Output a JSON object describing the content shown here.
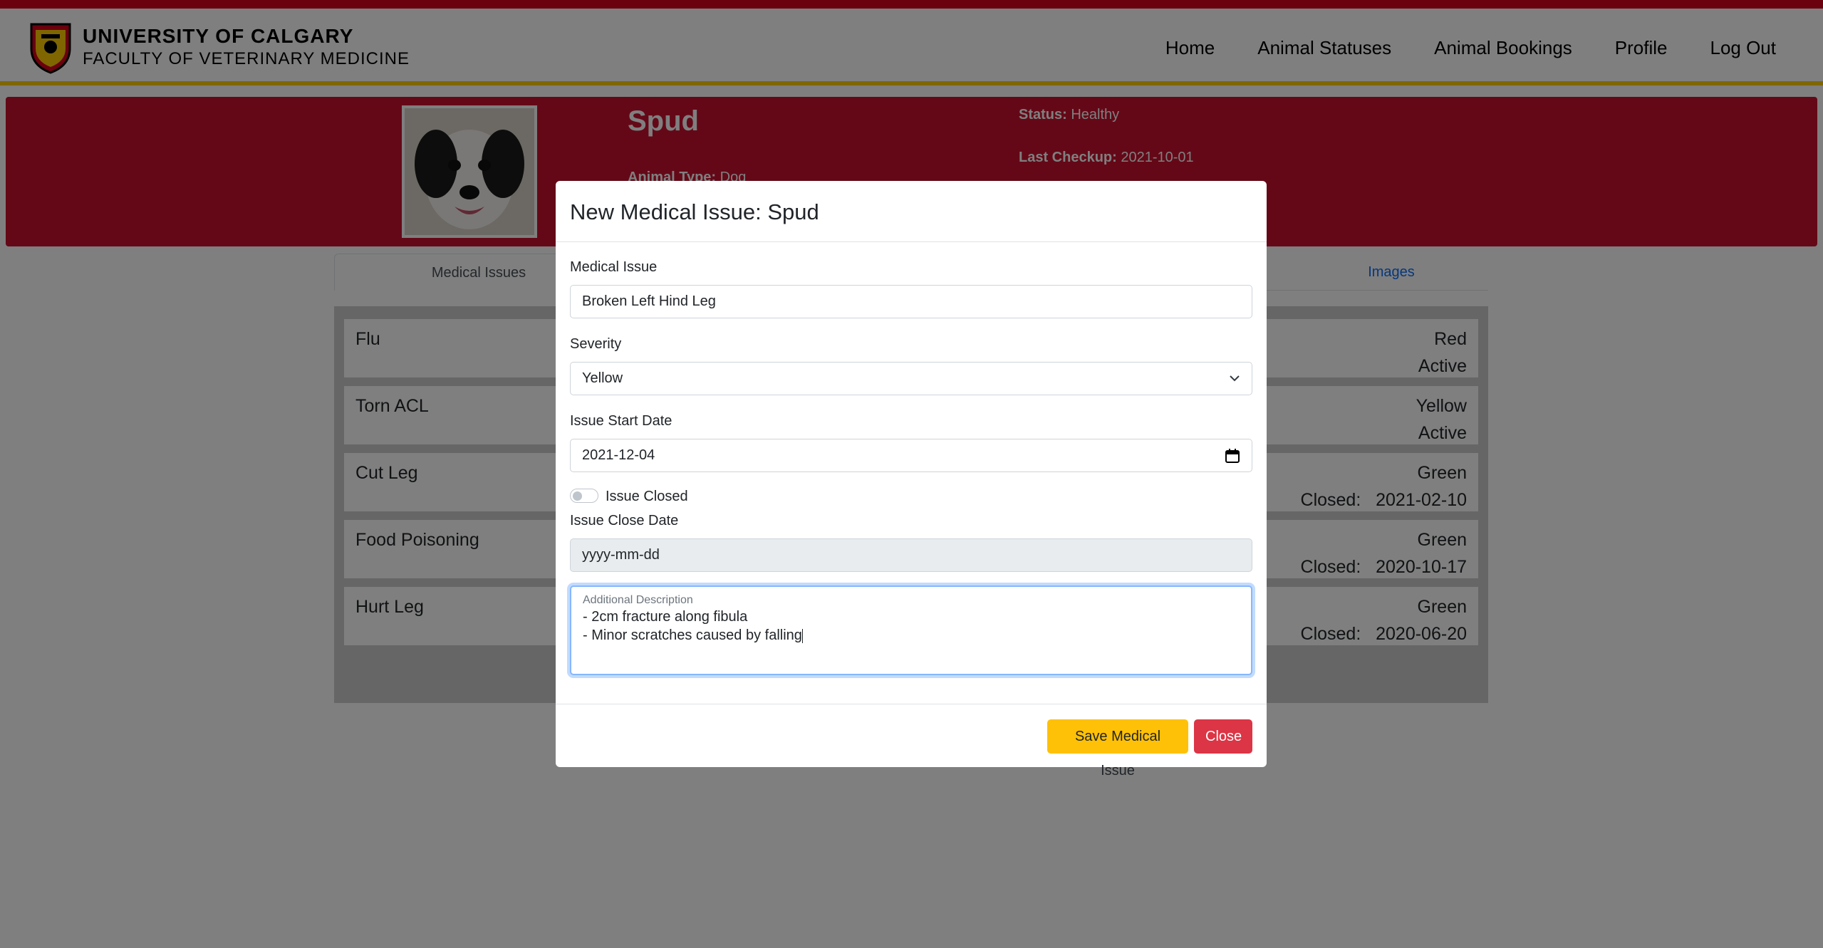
{
  "brand": {
    "line1": "UNIVERSITY OF CALGARY",
    "line2": "FACULTY OF VETERINARY MEDICINE"
  },
  "nav": {
    "home": "Home",
    "animal_statuses": "Animal Statuses",
    "animal_bookings": "Animal Bookings",
    "profile": "Profile",
    "log_out": "Log Out"
  },
  "animal": {
    "name": "Spud",
    "type_label": "Animal Type:",
    "type_value": "Dog",
    "status_label": "Status:",
    "status_value": "Healthy",
    "checkup_label": "Last Checkup:",
    "checkup_value": "2021-10-01"
  },
  "tabs": {
    "medical_issues": "Medical Issues",
    "images": "Images"
  },
  "issues": [
    {
      "name": "Flu",
      "severity": "Red",
      "state": "Active"
    },
    {
      "name": "Torn ACL",
      "severity": "Yellow",
      "state": "Active"
    },
    {
      "name": "Cut Leg",
      "severity": "Green",
      "state": "Closed:   2021-02-10"
    },
    {
      "name": "Food Poisoning",
      "severity": "Green",
      "state": "Closed:   2020-10-17"
    },
    {
      "name": "Hurt Leg",
      "severity": "Green",
      "state": "Closed:   2020-06-20"
    }
  ],
  "modal": {
    "title": "New Medical Issue: Spud",
    "medical_issue_label": "Medical Issue",
    "medical_issue_value": "Broken Left Hind Leg",
    "severity_label": "Severity",
    "severity_value": "Yellow",
    "start_date_label": "Issue Start Date",
    "start_date_value": "2021-12-04",
    "issue_closed_label": "Issue Closed",
    "close_date_label": "Issue Close Date",
    "close_date_placeholder": "yyyy-mm-dd",
    "description_label": "Additional Description",
    "description_line1": "- 2cm fracture along fibula",
    "description_line2": "- Minor scratches caused by falling",
    "save_label": "Save Medical Issue",
    "close_label": "Close"
  },
  "colors": {
    "brand_red": "#c8102e",
    "brand_gold": "#ffcd00",
    "save_button": "#ffc107",
    "close_button": "#dc3545"
  }
}
